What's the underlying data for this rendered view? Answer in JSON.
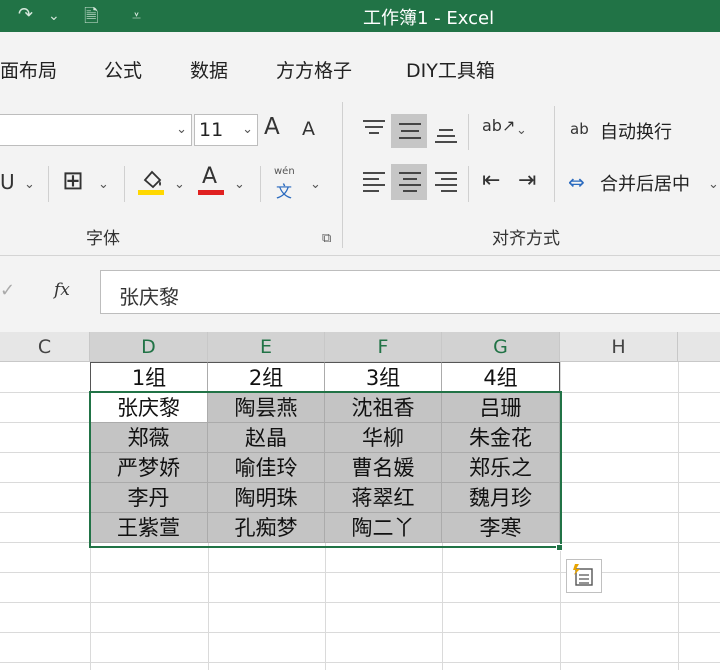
{
  "window": {
    "title": "工作簿1  -  Excel"
  },
  "quick_access": {
    "redo": "↷",
    "redo_more": "⌄",
    "save_as": "🗎",
    "customize": "⩡"
  },
  "menu": {
    "tabs": [
      "面布局",
      "公式",
      "数据",
      "方方格子",
      "DIY工具箱"
    ]
  },
  "font_group": {
    "label": "字体",
    "font_name": "",
    "font_size": "11",
    "dropdown": "⌄",
    "grow": "A",
    "shrink": "A",
    "underline": "U",
    "borders": "⊞",
    "fill_color": "#ffd800",
    "font_color": "#e02020",
    "font_letter": "A",
    "phonetic_top": "wén",
    "phonetic_bottom": "文",
    "launcher": "⧉"
  },
  "align_group": {
    "label": "对齐方式",
    "wrap_text": "自动换行",
    "merge_center": "合并后居中",
    "wrap_icon": "ab",
    "merge_icon": "⇔",
    "orientation_icon": "ab↗",
    "indent_dec": "⇤",
    "indent_inc": "⇥",
    "more": "⌄"
  },
  "formula_bar": {
    "fx": "fx",
    "check": "✓",
    "value": "张庆黎"
  },
  "sheet": {
    "columns": [
      "C",
      "D",
      "E",
      "F",
      "G",
      "H"
    ],
    "headers": [
      "1组",
      "2组",
      "3组",
      "4组"
    ],
    "rows": [
      [
        "张庆黎",
        "陶昙燕",
        "沈祖香",
        "吕珊"
      ],
      [
        "郑薇",
        "赵晶",
        "华柳",
        "朱金花"
      ],
      [
        "严梦娇",
        "喻佳玲",
        "曹名媛",
        "郑乐之"
      ],
      [
        "李丹",
        "陶明珠",
        "蒋翠红",
        "魏月珍"
      ],
      [
        "王紫萱",
        "孔痴梦",
        "陶二丫",
        "李寒"
      ]
    ],
    "quick_analysis_icon": "⚡"
  }
}
